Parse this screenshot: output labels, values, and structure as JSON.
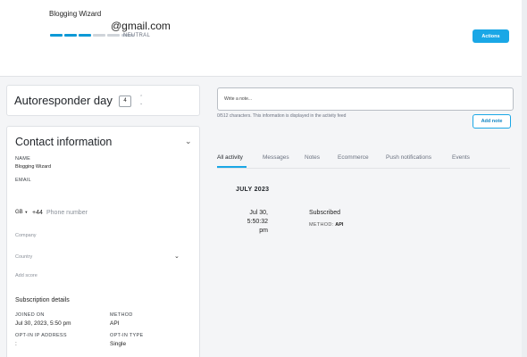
{
  "header": {
    "subscriber_name": "Blogging Wizard",
    "subscriber_email": "@gmail.com",
    "score_segments": 6,
    "score_filled": 3,
    "score_label": "NEUTRAL",
    "actions_label": "Actions"
  },
  "autoresponder": {
    "title": "Autoresponder day",
    "day_value": "4"
  },
  "contact": {
    "title": "Contact information",
    "name_label": "NAME",
    "name_value": "Blogging Wizard",
    "email_label": "EMAIL",
    "phone_country": "GB",
    "phone_code": "+44",
    "phone_placeholder": "Phone number",
    "company_placeholder": "Company",
    "country_placeholder": "Country",
    "add_score_placeholder": "Add score",
    "subscription_title": "Subscription details",
    "joined_label": "JOINED ON",
    "joined_value": "Jul 30, 2023, 5:50 pm",
    "method_label": "METHOD",
    "method_value": "API",
    "optin_ip_label": "OPT-IN IP ADDRESS",
    "optin_ip_value": ":",
    "optin_type_label": "OPT-IN TYPE",
    "optin_type_value": "Single"
  },
  "notes": {
    "placeholder": "Write a note...",
    "help_text": "0/512 characters. This information is displayed in the activity feed",
    "add_label": "Add note"
  },
  "tabs": [
    "All activity",
    "Messages",
    "Notes",
    "Ecommerce",
    "Push notifications",
    "Events"
  ],
  "activity": {
    "month": "JULY 2023",
    "date_line1": "Jul 30,",
    "date_line2": "5:50:32",
    "date_line3": "pm",
    "title": "Subscribed",
    "method_label": "METHOD:",
    "method_value": "API"
  },
  "colors": {
    "accent": "#1aa7e6",
    "score_filled": "#0d99d6",
    "score_empty": "#cfd4da"
  }
}
